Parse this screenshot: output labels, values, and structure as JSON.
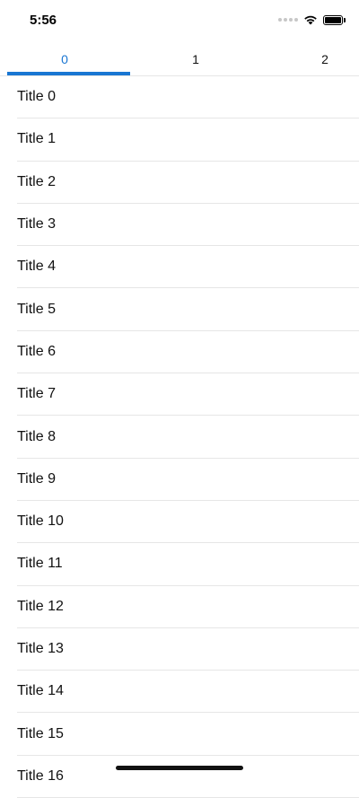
{
  "status_bar": {
    "time": "5:56"
  },
  "tabs": [
    {
      "label": "0",
      "active": true
    },
    {
      "label": "1",
      "active": false
    },
    {
      "label": "2",
      "active": false
    }
  ],
  "list": {
    "items": [
      "Title 0",
      "Title 1",
      "Title 2",
      "Title 3",
      "Title 4",
      "Title 5",
      "Title 6",
      "Title 7",
      "Title 8",
      "Title 9",
      "Title 10",
      "Title 11",
      "Title 12",
      "Title 13",
      "Title 14",
      "Title 15",
      "Title 16"
    ]
  },
  "colors": {
    "accent": "#1976d2",
    "divider": "#e6e6e6",
    "text": "#111111"
  }
}
